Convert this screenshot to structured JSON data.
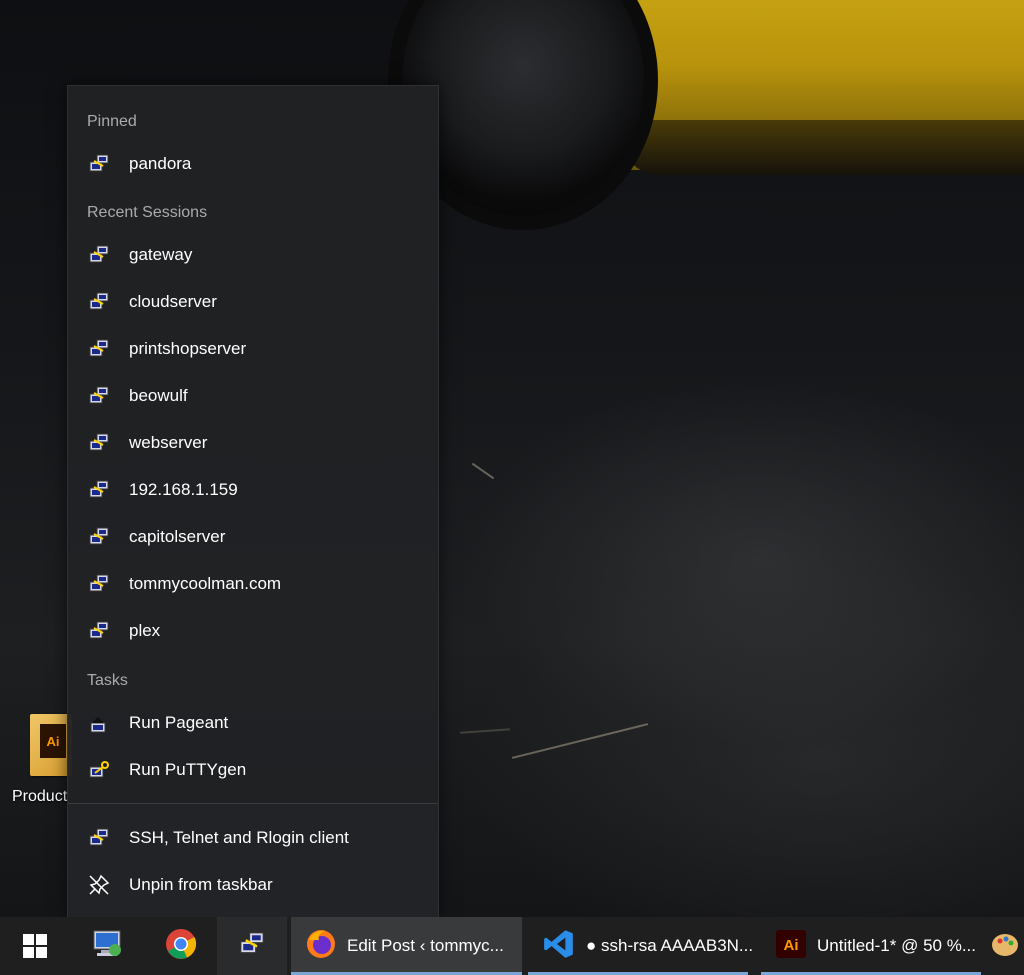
{
  "desktop": {
    "icon_label": "Product",
    "icon_tag": "Ai"
  },
  "jumplist": {
    "pinned_header": "Pinned",
    "pinned": [
      {
        "label": "pandora",
        "icon": "putty-session-icon"
      }
    ],
    "recent_header": "Recent Sessions",
    "recent": [
      {
        "label": "gateway",
        "icon": "putty-session-icon"
      },
      {
        "label": "cloudserver",
        "icon": "putty-session-icon"
      },
      {
        "label": "printshopserver",
        "icon": "putty-session-icon"
      },
      {
        "label": "beowulf",
        "icon": "putty-session-icon"
      },
      {
        "label": "webserver",
        "icon": "putty-session-icon"
      },
      {
        "label": "192.168.1.159",
        "icon": "putty-session-icon"
      },
      {
        "label": "capitolserver",
        "icon": "putty-session-icon"
      },
      {
        "label": "tommycoolman.com",
        "icon": "putty-session-icon"
      },
      {
        "label": "plex",
        "icon": "putty-session-icon"
      }
    ],
    "tasks_header": "Tasks",
    "tasks": [
      {
        "label": "Run Pageant",
        "icon": "pageant-icon"
      },
      {
        "label": "Run PuTTYgen",
        "icon": "puttygen-icon"
      }
    ],
    "footer": [
      {
        "label": "SSH, Telnet and Rlogin client",
        "icon": "putty-icon"
      },
      {
        "label": "Unpin from taskbar",
        "icon": "unpin-icon"
      }
    ]
  },
  "taskbar": {
    "start_icon": "windows-start-icon",
    "pinned": [
      {
        "icon": "this-pc-icon"
      },
      {
        "icon": "chrome-icon"
      },
      {
        "icon": "putty-icon"
      }
    ],
    "apps": [
      {
        "label": "Edit Post ‹ tommyc...",
        "icon": "firefox-icon"
      },
      {
        "label": "● ssh-rsa AAAAB3N...",
        "icon": "vscode-icon"
      },
      {
        "label": "Untitled-1* @ 50 %...",
        "icon": "illustrator-icon"
      }
    ],
    "accent_color": "#7aa6d6"
  }
}
